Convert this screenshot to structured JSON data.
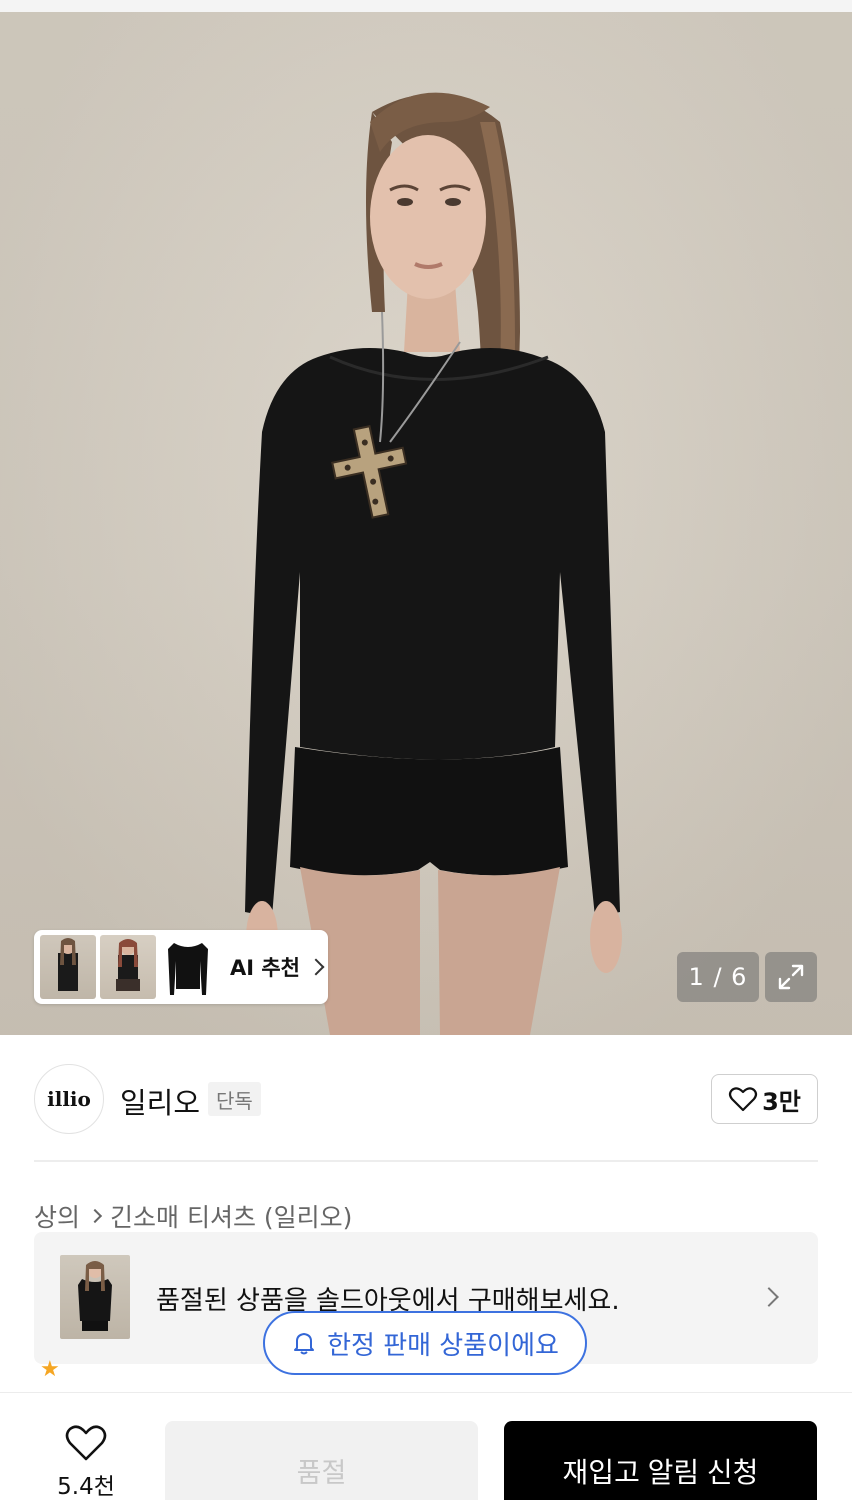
{
  "hero": {
    "image_description": "Model in long-sleeve black t-shirt with leopard cross pendant and black shorts",
    "ai_chip": {
      "label": "AI 추천",
      "thumbnail_count": 3
    },
    "counter": "1 / 6",
    "icons": {
      "expand": "expand-icon",
      "chevron": "chevron-right-icon"
    }
  },
  "brand": {
    "logo_text": "illio",
    "name": "일리오",
    "badge": "단독",
    "like_count": "3만"
  },
  "breadcrumb": {
    "items": [
      "상의",
      "긴소매 티셔츠 (일리오)"
    ]
  },
  "soldout_banner": {
    "text": "품절된 상품을 솔드아웃에서 구매해보세요."
  },
  "limited_notice": {
    "text": "한정 판매 상품이에요",
    "icon": "bell-icon"
  },
  "bottom_bar": {
    "wish_count": "5.4천",
    "soldout_label": "품절",
    "restock_label": "재입고 알림 신청"
  },
  "colors": {
    "accent_blue": "#3d72e0",
    "primary_black": "#000000",
    "disabled_gray": "#f1f1f1",
    "rating_star": "#f5a623"
  }
}
